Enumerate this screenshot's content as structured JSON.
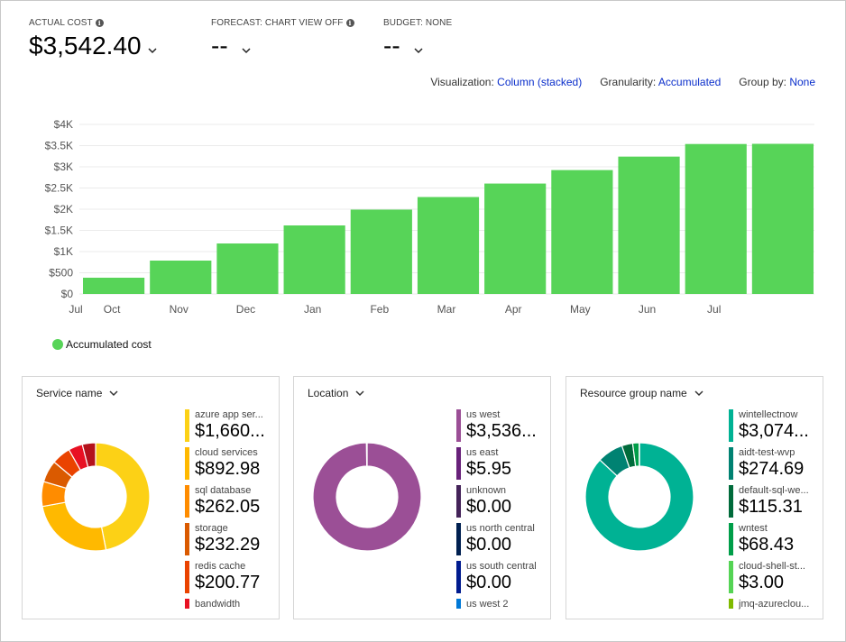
{
  "kpis": [
    {
      "label": "ACTUAL COST",
      "value": "$3,542.40",
      "has_info": true
    },
    {
      "label": "FORECAST: CHART VIEW OFF",
      "value": "--",
      "has_info": true
    },
    {
      "label": "BUDGET: NONE",
      "value": "--",
      "has_info": false
    }
  ],
  "options": {
    "visualization_label": "Visualization:",
    "visualization_value": "Column (stacked)",
    "granularity_label": "Granularity:",
    "granularity_value": "Accumulated",
    "groupby_label": "Group by:",
    "groupby_value": "None"
  },
  "chart_data": {
    "type": "bar",
    "title": "",
    "xlabel": "",
    "ylabel": "",
    "x_start_label": "Jul",
    "categories": [
      "Oct",
      "Nov",
      "Dec",
      "Jan",
      "Feb",
      "Mar",
      "Apr",
      "May",
      "Jun",
      "Jul",
      ""
    ],
    "series": [
      {
        "name": "Accumulated cost",
        "color": "#57d458",
        "values": [
          383,
          787,
          1191,
          1617,
          1990,
          2287,
          2605,
          2923,
          3241,
          3538,
          3542.4
        ]
      }
    ],
    "ylim": [
      0,
      4000
    ],
    "yticks": [
      0,
      500,
      1000,
      1500,
      2000,
      2500,
      3000,
      3500,
      4000
    ],
    "ytick_labels": [
      "$0",
      "$500",
      "$1K",
      "$1.5K",
      "$2K",
      "$2.5K",
      "$3K",
      "$3.5K",
      "$4K"
    ],
    "grid": true,
    "legend": "bottom-left"
  },
  "legend_label": "Accumulated cost",
  "breakdowns": [
    {
      "title": "Service name",
      "items": [
        {
          "name": "azure app ser...",
          "value": "$1,660...",
          "amount": 1660,
          "color": "#fcd116"
        },
        {
          "name": "cloud services",
          "value": "$892.98",
          "amount": 892.98,
          "color": "#ffb900"
        },
        {
          "name": "sql database",
          "value": "$262.05",
          "amount": 262.05,
          "color": "#ff8c00"
        },
        {
          "name": "storage",
          "value": "$232.29",
          "amount": 232.29,
          "color": "#da5a00"
        },
        {
          "name": "redis cache",
          "value": "$200.77",
          "amount": 200.77,
          "color": "#ea4300"
        },
        {
          "name": "bandwidth",
          "value": "",
          "amount": 150,
          "color": "#e81123"
        },
        {
          "name": "",
          "value": "",
          "amount": 140,
          "color": "#b4121c"
        }
      ]
    },
    {
      "title": "Location",
      "items": [
        {
          "name": "us west",
          "value": "$3,536...",
          "amount": 3536,
          "color": "#9b4f96"
        },
        {
          "name": "us east",
          "value": "$5.95",
          "amount": 5.95,
          "color": "#68217a"
        },
        {
          "name": "unknown",
          "value": "$0.00",
          "amount": 0,
          "color": "#442359"
        },
        {
          "name": "us north central",
          "value": "$0.00",
          "amount": 0,
          "color": "#002050"
        },
        {
          "name": "us south central",
          "value": "$0.00",
          "amount": 0,
          "color": "#001b8f"
        },
        {
          "name": "us west 2",
          "value": "",
          "amount": 0,
          "color": "#0078d7"
        }
      ]
    },
    {
      "title": "Resource group name",
      "items": [
        {
          "name": "wintellectnow",
          "value": "$3,074...",
          "amount": 3074,
          "color": "#00b294"
        },
        {
          "name": "aidt-test-wvp",
          "value": "$274.69",
          "amount": 274.69,
          "color": "#008272"
        },
        {
          "name": "default-sql-we...",
          "value": "$115.31",
          "amount": 115.31,
          "color": "#006b3b"
        },
        {
          "name": "wntest",
          "value": "$68.43",
          "amount": 68.43,
          "color": "#009e49"
        },
        {
          "name": "cloud-shell-st...",
          "value": "$3.00",
          "amount": 3.0,
          "color": "#55d455"
        },
        {
          "name": "jmq-azureclou...",
          "value": "",
          "amount": 0,
          "color": "#7fba00"
        }
      ]
    }
  ]
}
